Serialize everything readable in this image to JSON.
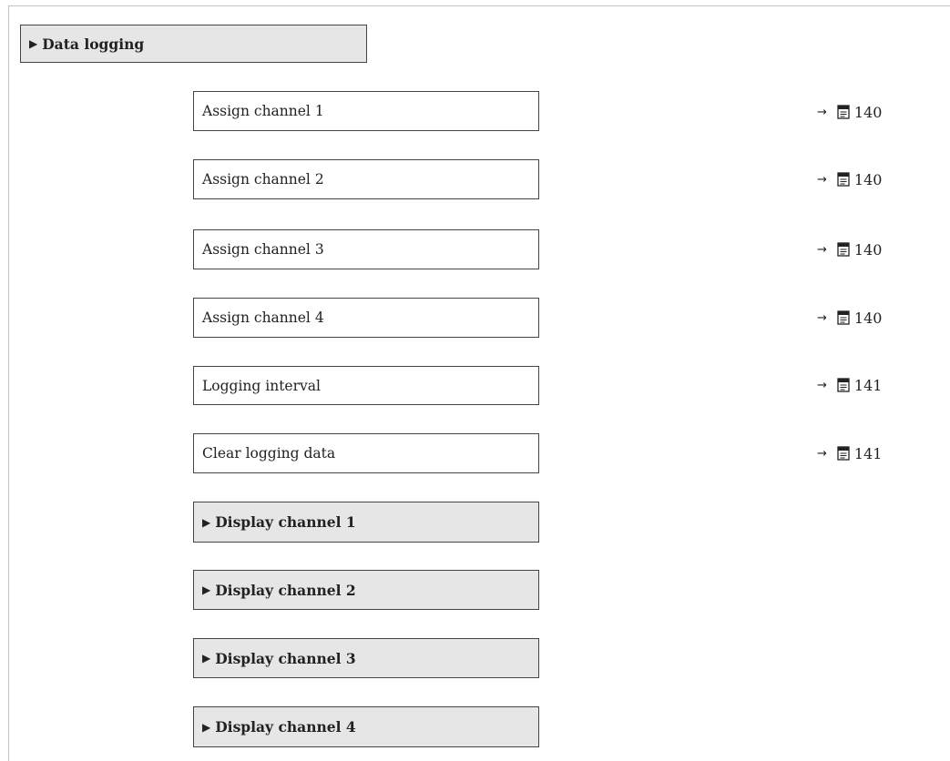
{
  "header": {
    "marker": "▶",
    "label": "Data logging"
  },
  "parameters": [
    {
      "label": "Assign channel 1",
      "arrow": "→",
      "page": "140"
    },
    {
      "label": "Assign channel 2",
      "arrow": "→",
      "page": "140"
    },
    {
      "label": "Assign channel 3",
      "arrow": "→",
      "page": "140"
    },
    {
      "label": "Assign channel 4",
      "arrow": "→",
      "page": "140"
    },
    {
      "label": "Logging interval",
      "arrow": "→",
      "page": "141"
    },
    {
      "label": "Clear logging data",
      "arrow": "→",
      "page": "141"
    }
  ],
  "submenus": [
    {
      "marker": "▶",
      "label": "Display channel 1"
    },
    {
      "marker": "▶",
      "label": "Display channel 2"
    },
    {
      "marker": "▶",
      "label": "Display channel 3"
    },
    {
      "marker": "▶",
      "label": "Display channel 4"
    }
  ],
  "icons": {
    "reference": "book-icon"
  }
}
